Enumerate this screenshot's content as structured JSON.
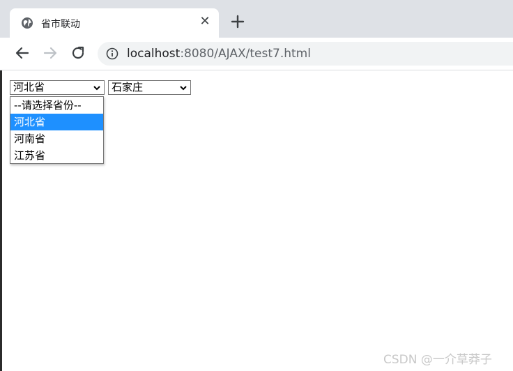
{
  "browser": {
    "tab_title": "省市联动",
    "url_host": "localhost",
    "url_rest": ":8080/AJAX/test7.html",
    "close_glyph": "✕"
  },
  "page": {
    "province_select": {
      "selected": "河北省",
      "options": [
        "--请选择省份--",
        "河北省",
        "河南省",
        "江苏省"
      ],
      "highlighted_index": 1
    },
    "city_select": {
      "selected": "石家庄"
    }
  },
  "watermark": "CSDN @一介草莽子",
  "colors": {
    "highlight": "#1e90ff",
    "chrome": "#dee1e6"
  }
}
